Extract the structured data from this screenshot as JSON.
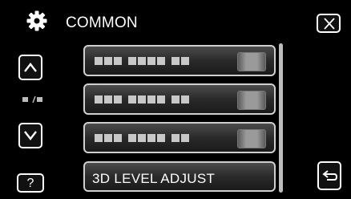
{
  "header": {
    "title": "COMMON",
    "icon": "gear-icon"
  },
  "nav": {
    "up_icon": "chevron-up-icon",
    "down_icon": "chevron-down-icon",
    "help_label": "?",
    "back_icon": "return-arrow-icon",
    "close_icon": "close-icon"
  },
  "list": {
    "items": [
      {
        "label": ""
      },
      {
        "label": ""
      },
      {
        "label": ""
      },
      {
        "label": "3D LEVEL ADJUST"
      }
    ]
  }
}
